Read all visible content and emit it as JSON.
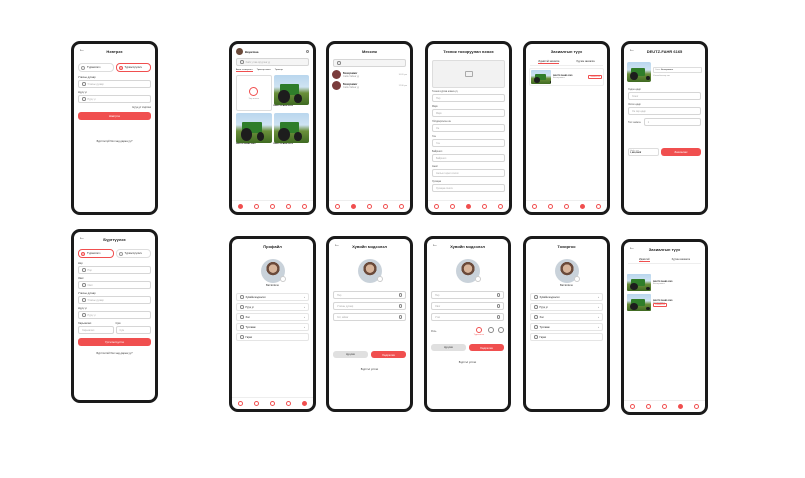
{
  "login": {
    "title": "Нэвтрэх",
    "user_types": [
      "Түрээслэгч",
      "Түрээслүүлэгч"
    ],
    "phone_label": "Утасны дугаар",
    "phone_placeholder": "Утасны дугаар",
    "password_label": "Нууц үг",
    "password_placeholder": "Нууц үг",
    "forgot_label": "Нууц үг сэргээх",
    "submit_label": "Нэвтрэх",
    "register_prompt": "Бүртгэлгүй бол энд дарна уу?"
  },
  "register": {
    "title": "Бүртгүүлэх",
    "user_types": [
      "Түрээслэгч",
      "Түрээслүүлэгч"
    ],
    "fields": [
      {
        "label": "Нэр",
        "placeholder": "Нэр"
      },
      {
        "label": "Овог",
        "placeholder": "Овог"
      },
      {
        "label": "Утасны дугаар",
        "placeholder": "Утасны дугаар"
      },
      {
        "label": "Нууц үг",
        "placeholder": "Нууц үг"
      }
    ],
    "region_label": "Харьяалал",
    "region_placeholder": "Харьяалал",
    "branch_label": "Сум",
    "branch_placeholder": "Сум",
    "submit_label": "Үргэлжлүүлэх",
    "login_prompt": "Бүртгэлтэй бол энд дарна уу?"
  },
  "home": {
    "user_name": "Bayarmaa",
    "search_placeholder": "Хайх утгаа оруулна уу",
    "categories": [
      "Ачаа тээвэрлэгч",
      "Трактор ачигч",
      "Трактор"
    ],
    "add_label": "Зар нэмэх",
    "listings": [
      "DEUTZ-FAHR 6165",
      "DEUTZ-FAHR 5080",
      "DEUTZ-FAHR 5070"
    ]
  },
  "messages": {
    "title": "Мессеж",
    "threads": [
      {
        "name": "Болорчимэг",
        "preview": "Сайн байна уу",
        "time": "10:20 pm"
      },
      {
        "name": "Болорчимэг",
        "preview": "Сайн байна уу",
        "time": "12:30 pm"
      }
    ]
  },
  "add_equipment": {
    "title": "Техник тохируулан нэмэх",
    "photo_label": "Техник зургаа нэмнэ үү",
    "fields": [
      {
        "label": "",
        "placeholder": "Нэр"
      },
      {
        "label": "Марк",
        "placeholder": "Марк"
      },
      {
        "label": "Үйлдвэрлэсэн он",
        "placeholder": "Он"
      },
      {
        "label": "Үнэ",
        "placeholder": "Үнэ"
      },
      {
        "label": "Байршил",
        "placeholder": "Байршил"
      },
      {
        "label": "Ажил",
        "placeholder": "Ажлын төрөл сонгох"
      },
      {
        "label": "Хугацаа",
        "placeholder": "Хугацаа сонгох"
      }
    ]
  },
  "orders": {
    "title": "Захиалгын түүх",
    "tabs": [
      "Идэвхтэй захиалга",
      "Хуучин захиалга"
    ],
    "items": [
      {
        "name": "DEUTZ-FAHR 6165",
        "owner": "Болорчимэг",
        "status": "Захиалсан"
      }
    ]
  },
  "detail": {
    "title": "DEUTZ-FAHR 6165",
    "owner_label": "Эзэн:",
    "owner_name": "Болорчимэг",
    "location": "Улаанбаатар хот",
    "days_label": "Хэдэн өдөр",
    "days_placeholder": "Хоног",
    "start_label": "Эхлэх өдөр",
    "start_placeholder": "Он сар өдөр",
    "qty_label": "Тоо хэмжээ",
    "qty_value": "1",
    "total_label": "Нийт үнэ",
    "total_value": "1,000,000₮",
    "order_label": "Захиалах"
  },
  "profile": {
    "title": "Профайл",
    "name": "Bat Erdene",
    "menu": [
      "Хувийн мэдээлэл",
      "Нууц үг",
      "Хэл",
      "Тусламж",
      "Гарах"
    ]
  },
  "edit_profile_1": {
    "title": "Хувийн мэдээлэл",
    "fields": [
      "Нэр",
      "Утасны дугаар",
      "Хот, аймаг"
    ],
    "cancel_label": "Цуцлах",
    "save_label": "Хадгалах",
    "logout_label": "Бүртгэл устгах"
  },
  "edit_profile_2": {
    "title": "Хувийн мэдээлэл",
    "fields": [
      "Нэр",
      "Овог",
      "Утас"
    ],
    "role_label": "Роль",
    "role_options": [
      "Түрээслэгч",
      "",
      ""
    ],
    "cancel_label": "Цуцлах",
    "save_label": "Хадгалах",
    "logout_label": "Бүртгэл устгах"
  },
  "settings": {
    "title": "Тохиргоо",
    "name": "Bat Erdene",
    "menu": [
      "Хувийн мэдээлэл",
      "Нууц үг",
      "Хэл",
      "Тусламж",
      "Гарах"
    ]
  },
  "orders_2": {
    "title": "Захиалгын түүх",
    "tabs": [
      "Идэвхтэй",
      "Хуучин захиалга"
    ],
    "items": [
      {
        "name": "DEUTZ-FAHR 6165",
        "owner": "Болорчимэг",
        "status": ""
      },
      {
        "name": "DEUTZ-FAHR 6165",
        "owner": "Болорчимэг",
        "status": "Захиалсан"
      }
    ]
  }
}
